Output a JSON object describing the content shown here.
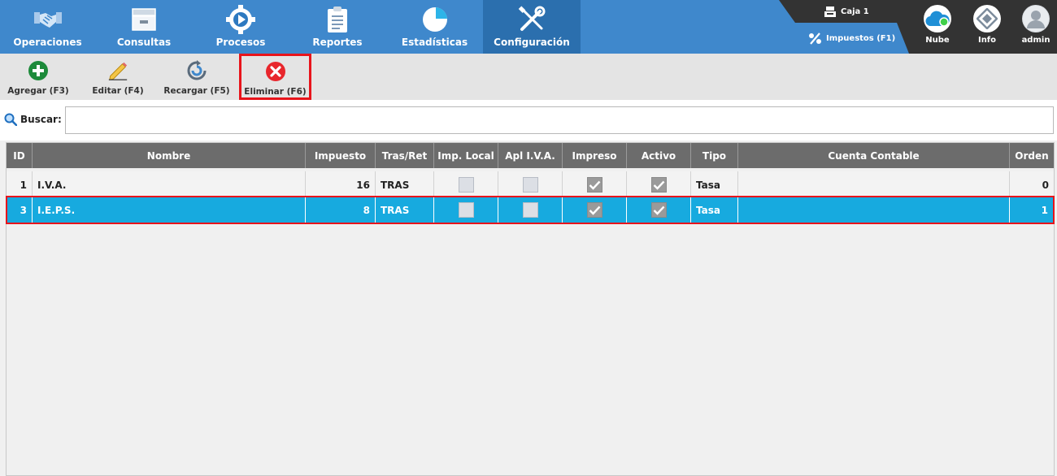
{
  "nav": {
    "items": [
      {
        "label": "Operaciones",
        "icon": "handshake-icon"
      },
      {
        "label": "Consultas",
        "icon": "archive-icon"
      },
      {
        "label": "Procesos",
        "icon": "gear-icon"
      },
      {
        "label": "Reportes",
        "icon": "clipboard-icon"
      },
      {
        "label": "Estadísticas",
        "icon": "pie-chart-icon"
      },
      {
        "label": "Configuración",
        "icon": "wrench-screwdriver-icon"
      }
    ],
    "active_index": 5,
    "status": {
      "caja": "Caja 1",
      "impuestos": "Impuestos (F1)"
    },
    "right_buttons": [
      {
        "label": "Nube",
        "icon": "cloud-icon"
      },
      {
        "label": "Info",
        "icon": "info-diamond-icon"
      },
      {
        "label": "admin",
        "icon": "user-avatar-icon"
      }
    ]
  },
  "toolbar": {
    "buttons": [
      {
        "label": "Agregar (F3)",
        "icon": "plus-circle-icon"
      },
      {
        "label": "Editar (F4)",
        "icon": "pencil-icon"
      },
      {
        "label": "Recargar (F5)",
        "icon": "reload-icon"
      },
      {
        "label": "Eliminar (F6)",
        "icon": "delete-x-icon"
      }
    ],
    "highlighted_index": 3
  },
  "search": {
    "label": "Buscar:",
    "value": "",
    "placeholder": ""
  },
  "table": {
    "columns": [
      "ID",
      "Nombre",
      "Impuesto",
      "Tras/Ret",
      "Imp. Local",
      "Apl I.V.A.",
      "Impreso",
      "Activo",
      "Tipo",
      "Cuenta Contable",
      "Orden"
    ],
    "rows": [
      {
        "id": "1",
        "nombre": "I.V.A.",
        "impuesto": "16",
        "tras_ret": "TRAS",
        "imp_local": false,
        "apl_iva": false,
        "impreso": true,
        "activo": true,
        "tipo": "Tasa",
        "cuenta": "",
        "orden": "0"
      },
      {
        "id": "3",
        "nombre": "I.E.P.S.",
        "impuesto": "8",
        "tras_ret": "TRAS",
        "imp_local": false,
        "apl_iva": false,
        "impreso": true,
        "activo": true,
        "tipo": "Tasa",
        "cuenta": "",
        "orden": "1"
      }
    ],
    "selected_row": 1
  },
  "colors": {
    "nav_bg": "#3f88cc",
    "nav_active": "#2b6fae",
    "header_bg": "#6c6c6c",
    "selected_row": "#17aadf",
    "highlight_border": "#e8141b"
  }
}
